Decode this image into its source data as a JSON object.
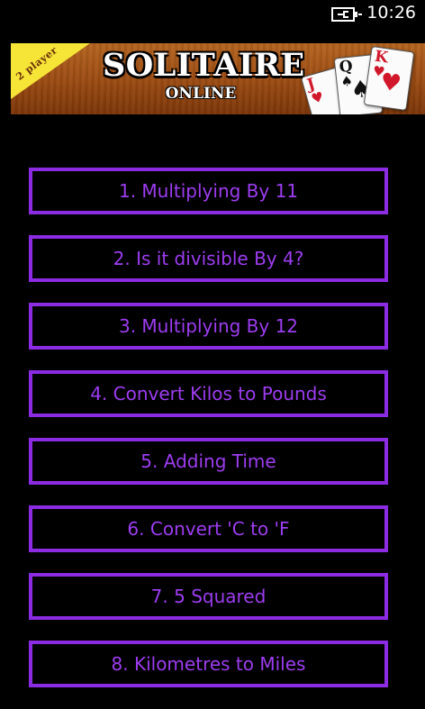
{
  "status_bar": {
    "time": "10:26",
    "battery_icon": "battery-charging-icon"
  },
  "ad_banner": {
    "ribbon_text": "2 player",
    "title": "SOLITAIRE",
    "subtitle": "ONLINE",
    "cards": [
      {
        "rank": "J",
        "suit": "♥",
        "color": "red"
      },
      {
        "rank": "Q",
        "suit": "♠",
        "color": "black"
      },
      {
        "rank": "K",
        "suit": "♥",
        "color": "red"
      }
    ]
  },
  "menu": {
    "accent_color": "#8b2be2",
    "text_color": "#9d3df0",
    "items": [
      {
        "label": "1. Multiplying By 11"
      },
      {
        "label": "2. Is it divisible By 4?"
      },
      {
        "label": "3. Multiplying By 12"
      },
      {
        "label": "4. Convert Kilos to Pounds"
      },
      {
        "label": "5. Adding Time"
      },
      {
        "label": "6. Convert 'C to 'F"
      },
      {
        "label": "7. 5 Squared"
      },
      {
        "label": "8. Kilometres to Miles"
      }
    ]
  }
}
